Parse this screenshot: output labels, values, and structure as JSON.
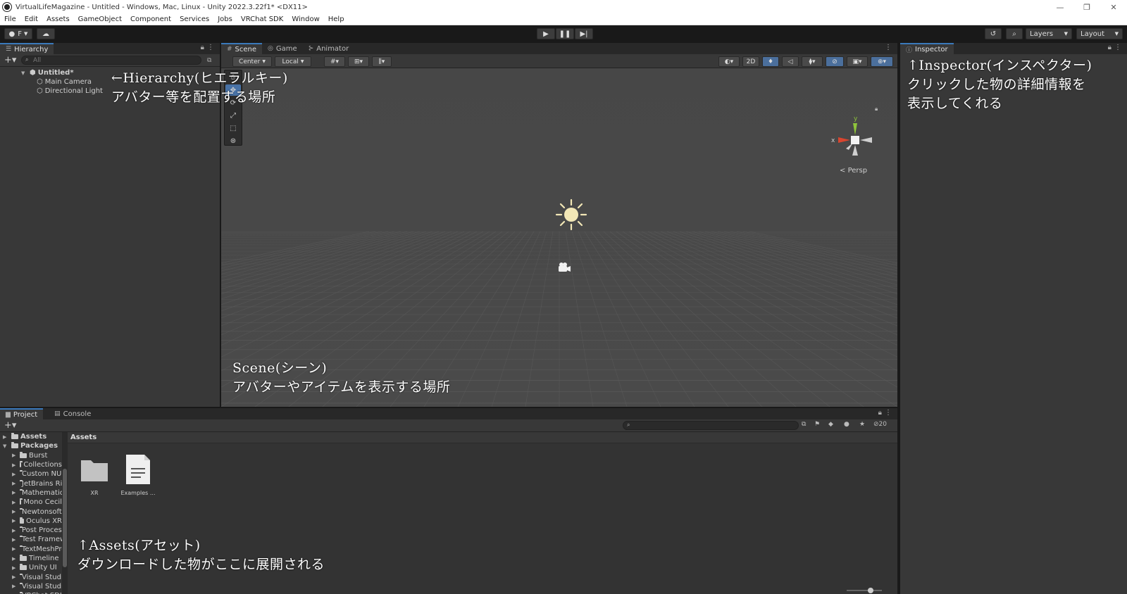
{
  "window": {
    "title": "VirtualLifeMagazine - Untitled - Windows, Mac, Linux - Unity 2022.3.22f1* <DX11>",
    "controls": [
      "—",
      "❐",
      "✕"
    ]
  },
  "menu": [
    "File",
    "Edit",
    "Assets",
    "GameObject",
    "Component",
    "Services",
    "Jobs",
    "VRChat SDK",
    "Window",
    "Help"
  ],
  "toolbar": {
    "account_label": "F",
    "layers_label": "Layers",
    "layout_label": "Layout"
  },
  "hierarchy": {
    "tab": "Hierarchy",
    "search_placeholder": "All",
    "scene_name": "Untitled*",
    "items": [
      "Main Camera",
      "Directional Light"
    ]
  },
  "scene": {
    "tabs": [
      "Scene",
      "Game",
      "Animator"
    ],
    "pivot_label": "Center",
    "space_label": "Local",
    "mode_2d": "2D",
    "persp_label": "Persp",
    "axis_y": "y",
    "axis_x": "x"
  },
  "inspector": {
    "tab": "Inspector"
  },
  "project": {
    "tabs": [
      "Project",
      "Console"
    ],
    "tree_root_assets": "Assets",
    "tree_root_packages": "Packages",
    "packages": [
      "Burst",
      "Collections",
      "Custom NUnit",
      "JetBrains Rider",
      "Mathematics",
      "Mono Cecil",
      "Newtonsoft Json",
      "Oculus XR",
      "Post Processing",
      "Test Framework",
      "TextMeshPro",
      "Timeline",
      "Unity UI",
      "Visual Studio",
      "Visual Studio",
      "VRChat SDK"
    ],
    "breadcrumb": "Assets",
    "assets": [
      "XR",
      "Examples ..."
    ],
    "hidden_count": "20"
  },
  "annotations": {
    "hierarchy_line1": "←Hierarchy(ヒエラルキー)",
    "hierarchy_line2": "アバター等を配置する場所",
    "inspector_line1": "↑Inspector(インスペクター)",
    "inspector_line2": "クリックした物の詳細情報を",
    "inspector_line3": "表示してくれる",
    "scene_line1": "Scene(シーン)",
    "scene_line2": "アバターやアイテムを表示する場所",
    "assets_line1": "↑Assets(アセット)",
    "assets_line2": "ダウンロードした物がここに展開される"
  },
  "colors": {
    "accent": "#3a79bb",
    "selected_tool": "#4872a6",
    "scene_bg": "#474747",
    "panel_bg": "#383838"
  }
}
